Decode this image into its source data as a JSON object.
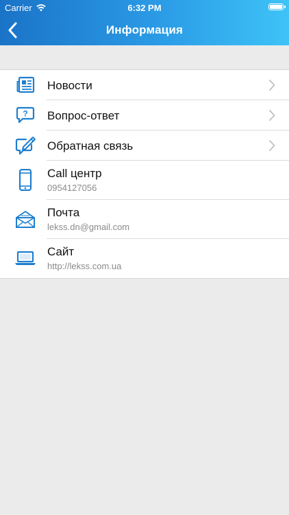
{
  "status_bar": {
    "carrier": "Carrier",
    "time": "6:32 PM"
  },
  "nav": {
    "title": "Информация"
  },
  "colors": {
    "accent": "#1e7fcf",
    "header_start": "#1a73c7",
    "header_end": "#3ec3f7",
    "background": "#ebebeb"
  },
  "menu": {
    "items": [
      {
        "label": "Новости",
        "icon": "newspaper-icon"
      },
      {
        "label": "Вопрос-ответ",
        "icon": "question-bubble-icon"
      },
      {
        "label": "Обратная связь",
        "icon": "feedback-pencil-icon"
      }
    ]
  },
  "contacts": {
    "items": [
      {
        "label": "Call центр",
        "value": "0954127056",
        "icon": "phone-icon"
      },
      {
        "label": "Почта",
        "value": "lekss.dn@gmail.com",
        "icon": "envelope-icon"
      },
      {
        "label": "Сайт",
        "value": "http://lekss.com.ua",
        "icon": "laptop-icon"
      }
    ]
  }
}
